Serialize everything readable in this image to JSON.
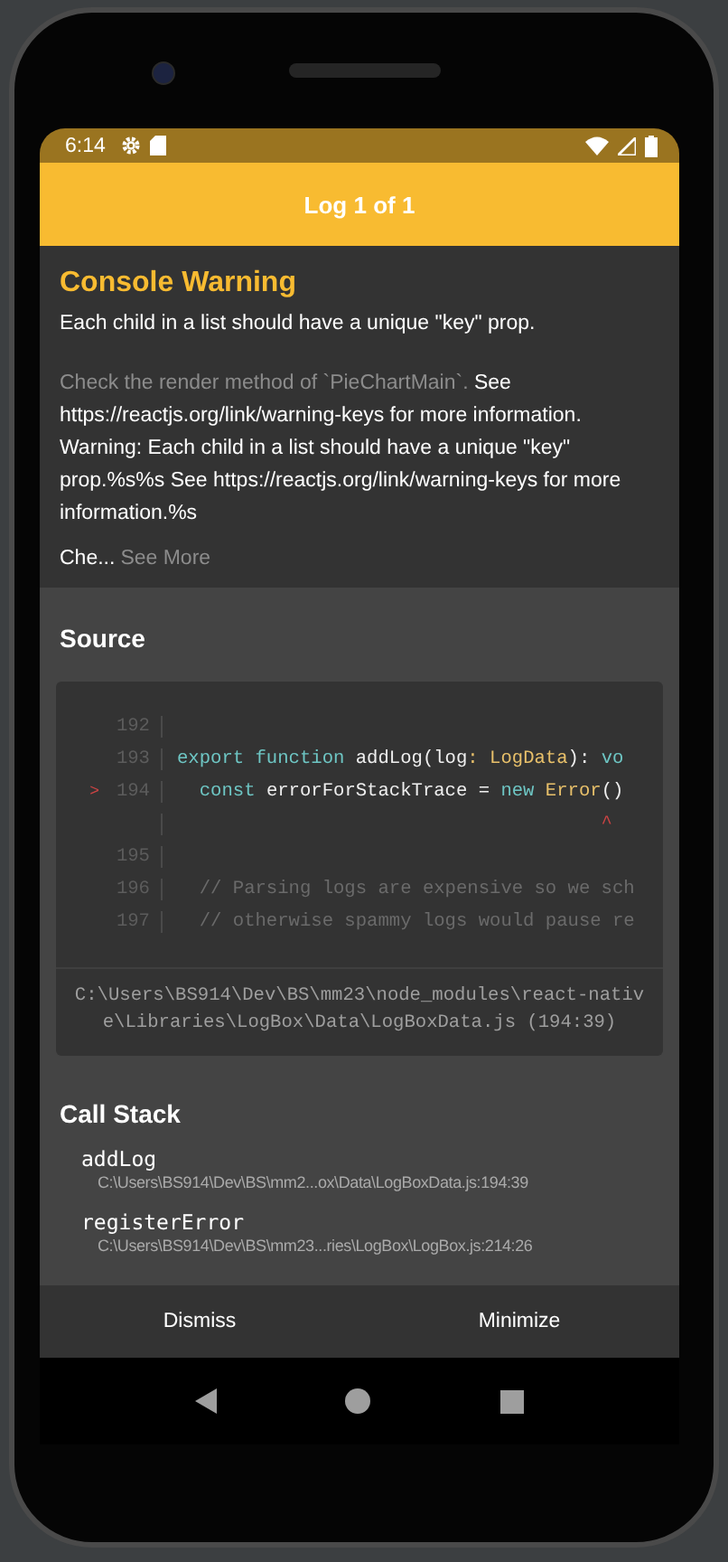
{
  "status_bar": {
    "time": "6:14"
  },
  "header": {
    "title": "Log 1 of 1"
  },
  "message": {
    "title": "Console Warning",
    "summary": "Each child in a list should have a unique \"key\" prop.",
    "parts": [
      {
        "text": "Check the render method of `PieChartMain`.",
        "kind": "muted"
      },
      {
        "text": " See https://reactjs.org/link/warning-keys for more information. Warning: Each child in a list should have a unique \"key\" prop.%s%s See https://reactjs.org/link/warning-keys for more information.%s",
        "kind": "plain"
      }
    ],
    "truncated": "Che...",
    "see_more": "See More"
  },
  "source": {
    "title": "Source",
    "lines": [
      {
        "number": "192"
      },
      {
        "number": "193",
        "segments": [
          {
            "text": "export function ",
            "kind": "keyword"
          },
          {
            "text": "addLog(log",
            "kind": "plain"
          },
          {
            "text": ": LogData",
            "kind": "type"
          },
          {
            "text": "): ",
            "kind": "plain"
          },
          {
            "text": "vo",
            "kind": "keyword"
          }
        ]
      },
      {
        "number": "194",
        "marker": ">",
        "segments": [
          {
            "text": "  const ",
            "kind": "keyword"
          },
          {
            "text": "errorForStackTrace = ",
            "kind": "plain"
          },
          {
            "text": "new ",
            "kind": "keyword"
          },
          {
            "text": "Error",
            "kind": "type"
          },
          {
            "text": "()",
            "kind": "plain"
          }
        ]
      },
      {
        "segments": [
          {
            "text": "                                      ^",
            "kind": "error"
          }
        ]
      },
      {
        "number": "195"
      },
      {
        "number": "196",
        "segments": [
          {
            "text": "  // Parsing logs are expensive so we sch",
            "kind": "comment"
          }
        ]
      },
      {
        "number": "197",
        "segments": [
          {
            "text": "  // otherwise spammy logs would pause re",
            "kind": "comment"
          }
        ]
      }
    ],
    "file": "C:\\Users\\BS914\\Dev\\BS\\mm23\\node_modules\\react-native\\Libraries\\LogBox\\Data\\LogBoxData.js (194:39)"
  },
  "call_stack": {
    "title": "Call Stack",
    "frames": [
      {
        "name": "addLog",
        "location": "C:\\Users\\BS914\\Dev\\BS\\mm2...ox\\Data\\LogBoxData.js:194:39"
      },
      {
        "name": "registerError",
        "location": "C:\\Users\\BS914\\Dev\\BS\\mm23...ries\\LogBox\\LogBox.js:214:26"
      }
    ]
  },
  "buttons": [
    "Dismiss",
    "Minimize"
  ]
}
